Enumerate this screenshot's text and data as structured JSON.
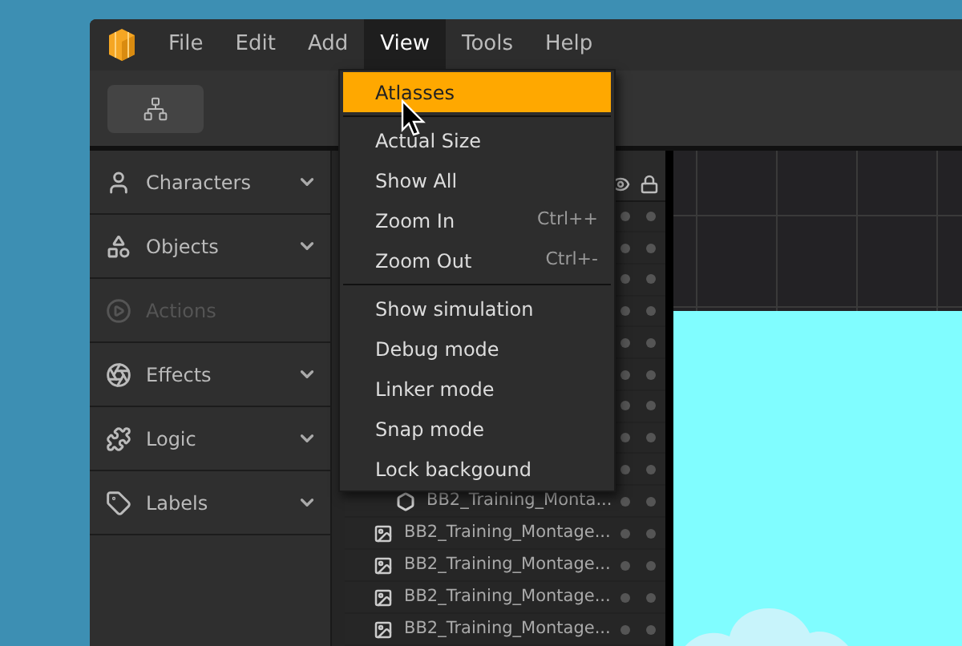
{
  "menu_bar": {
    "items": [
      {
        "label": "File",
        "selected": false
      },
      {
        "label": "Edit",
        "selected": false
      },
      {
        "label": "Add",
        "selected": false
      },
      {
        "label": "View",
        "selected": true
      },
      {
        "label": "Tools",
        "selected": false
      },
      {
        "label": "Help",
        "selected": false
      }
    ]
  },
  "sidebar": {
    "items": [
      {
        "label": "Characters",
        "disabled": false
      },
      {
        "label": "Objects",
        "disabled": false
      },
      {
        "label": "Actions",
        "disabled": true
      },
      {
        "label": "Effects",
        "disabled": false
      },
      {
        "label": "Logic",
        "disabled": false
      },
      {
        "label": "Labels",
        "disabled": false
      }
    ]
  },
  "layers": {
    "rows": [
      {
        "kind": "shape",
        "label": "BB2_Training_Monta..."
      },
      {
        "kind": "image",
        "label": "BB2_Training_Montage..."
      },
      {
        "kind": "image",
        "label": "BB2_Training_Montage..."
      },
      {
        "kind": "image",
        "label": "BB2_Training_Montage..."
      },
      {
        "kind": "image",
        "label": "BB2_Training_Montage..."
      }
    ]
  },
  "view_menu": {
    "items": [
      {
        "kind": "item",
        "label": "Atlasses",
        "selected": true
      },
      {
        "kind": "separator"
      },
      {
        "kind": "item",
        "label": "Actual Size",
        "selected": false
      },
      {
        "kind": "item",
        "label": "Show All",
        "selected": false
      },
      {
        "kind": "item",
        "label": "Zoom In",
        "shortcut": "Ctrl++",
        "selected": false
      },
      {
        "kind": "item",
        "label": "Zoom Out",
        "shortcut": "Ctrl+-",
        "selected": false
      },
      {
        "kind": "separator"
      },
      {
        "kind": "item",
        "label": "Show simulation",
        "selected": false
      },
      {
        "kind": "item",
        "label": "Debug mode",
        "selected": false
      },
      {
        "kind": "item",
        "label": "Linker mode",
        "selected": false
      },
      {
        "kind": "item",
        "label": "Snap mode",
        "selected": false
      },
      {
        "kind": "item",
        "label": "Lock backgound",
        "selected": false
      }
    ]
  }
}
